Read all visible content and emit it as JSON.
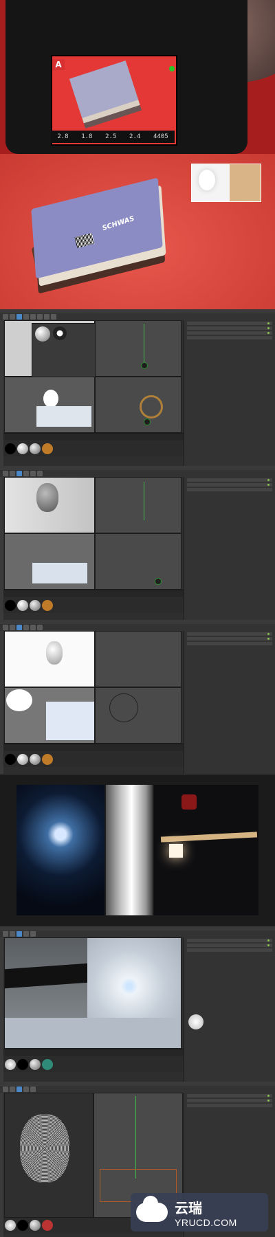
{
  "camera_panel": {
    "mode_label": "A",
    "readouts": [
      "2.8",
      "1.8",
      "2.5",
      "2.4"
    ],
    "shots_remaining": "4405"
  },
  "book_panel": {
    "book_title": "SCHWAS"
  },
  "apps": [
    {
      "id": "screen-1"
    },
    {
      "id": "screen-2"
    },
    {
      "id": "screen-3"
    },
    {
      "id": "screen-4"
    },
    {
      "id": "screen-5"
    }
  ],
  "watermark": {
    "chinese": "云瑞",
    "domain": "YRUCD.COM"
  },
  "colors": {
    "accent_green": "#3cbf4a",
    "panel_bg": "#2e2e2e",
    "red_carpet": "#c93a32"
  }
}
